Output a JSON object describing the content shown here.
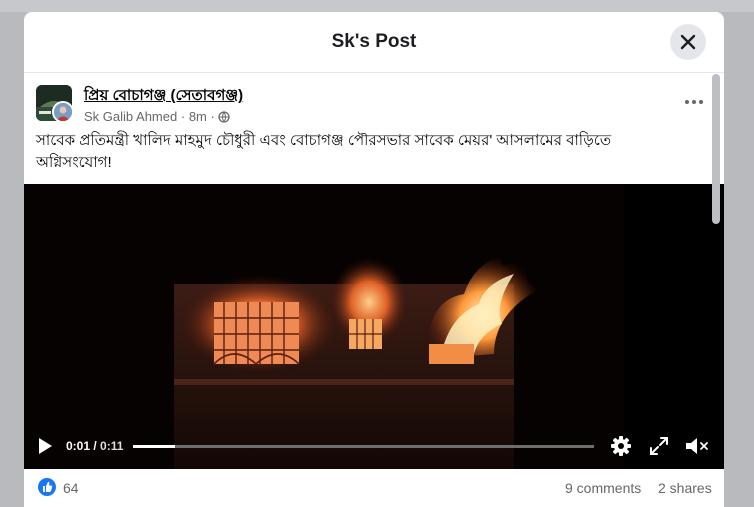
{
  "modal": {
    "title": "Sk's Post"
  },
  "post": {
    "page_name": "প্রিয় বোচাগঞ্জ (সেতাবগঞ্জ)",
    "author": "Sk Galib Ahmed",
    "time": "8m",
    "separator": "·",
    "audience_icon": "globe-icon",
    "text": "সাবেক প্রতিমন্ত্রী খালিদ মাহমুদ চৌধুরী এবং বোচাগঞ্জ পৌরসভার সাবেক মেয়র' আসলামের বাড়িতে অগ্নিসংযোগ!"
  },
  "video": {
    "current_time": "0:01",
    "total_time": "0:11",
    "time_separator": " / ",
    "progress_fraction": 0.091,
    "icons": [
      "play-icon",
      "gear-icon",
      "fullscreen-icon",
      "volume-muted-icon"
    ]
  },
  "stats": {
    "reactions": "64",
    "comments": "9 comments",
    "shares": "2 shares"
  },
  "colors": {
    "accent": "#1877f2",
    "text_primary": "#050505",
    "text_secondary": "#65676b",
    "close_bg": "#e4e6eb"
  }
}
